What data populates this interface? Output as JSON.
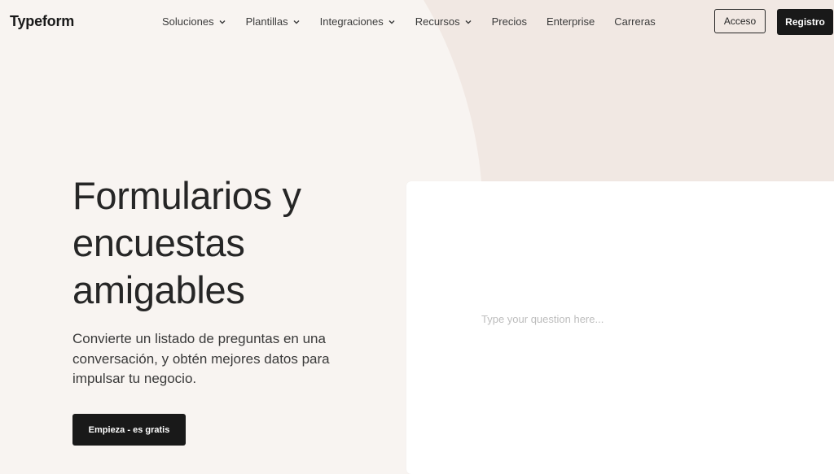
{
  "brand": {
    "logo_text": "Typeform"
  },
  "nav": {
    "items": [
      {
        "label": "Soluciones",
        "has_dropdown": true
      },
      {
        "label": "Plantillas",
        "has_dropdown": true
      },
      {
        "label": "Integraciones",
        "has_dropdown": true
      },
      {
        "label": "Recursos",
        "has_dropdown": true
      },
      {
        "label": "Precios",
        "has_dropdown": false
      },
      {
        "label": "Enterprise",
        "has_dropdown": false
      },
      {
        "label": "Carreras",
        "has_dropdown": false
      }
    ]
  },
  "auth": {
    "login_label": "Acceso",
    "signup_label": "Registro"
  },
  "hero": {
    "title_lines": [
      "Formularios y",
      "encuestas",
      "amigables"
    ],
    "subtitle": "Convierte un listado de preguntas en una conversación, y obtén mejores datos para impulsar tu negocio.",
    "cta_label": "Empieza - es gratis"
  },
  "demo": {
    "question_placeholder": "Type your question here..."
  },
  "colors": {
    "page_background": "#f8f4f1",
    "accent_shape": "#f1e8e3",
    "dark_button": "#191919",
    "card_background": "#ffffff",
    "text_primary": "#262626"
  },
  "icons": {
    "dropdown": "chevron-down-icon"
  }
}
